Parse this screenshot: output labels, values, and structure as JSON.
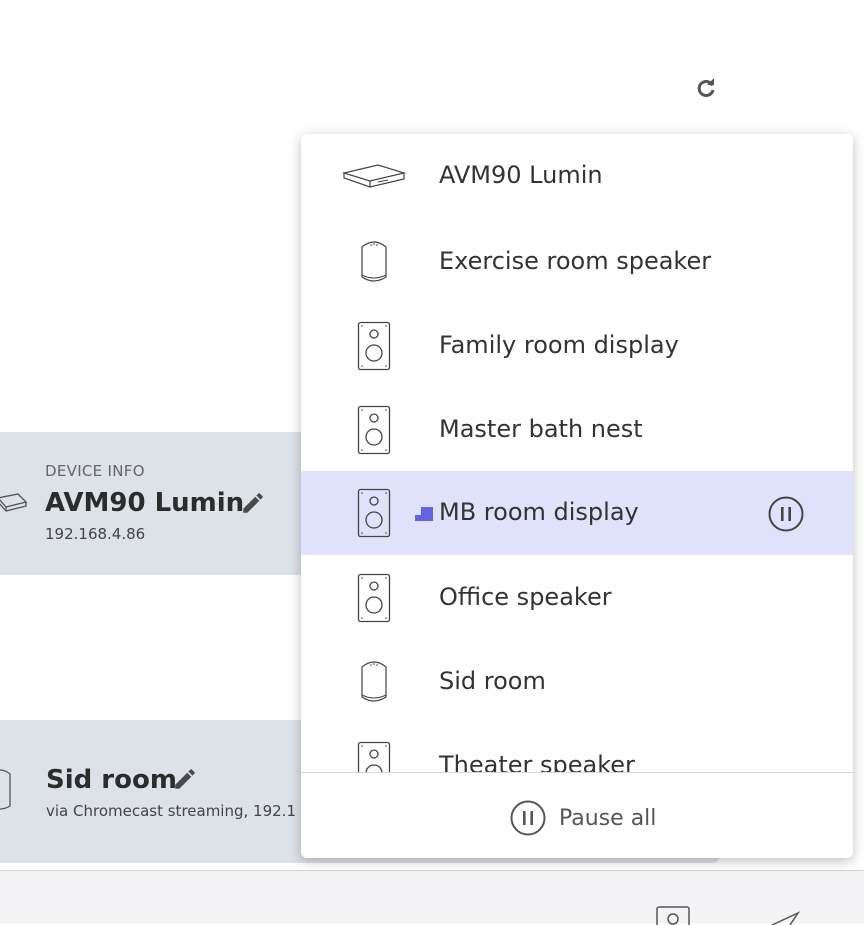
{
  "device_info": {
    "label": "DEVICE INFO",
    "name": "AVM90 Lumin",
    "ip": "192.168.4.86"
  },
  "sid_card": {
    "name": "Sid room",
    "subtitle": "via Chromecast streaming, 192.1"
  },
  "dropdown": {
    "items": [
      {
        "label": "AVM90 Lumin",
        "icon": "streamer-icon"
      },
      {
        "label": "Exercise room speaker",
        "icon": "smart-speaker-icon"
      },
      {
        "label": "Family room display",
        "icon": "speaker-icon"
      },
      {
        "label": "Master bath nest",
        "icon": "speaker-icon"
      },
      {
        "label": "MB room display",
        "icon": "speaker-icon",
        "selected": true,
        "playing": true
      },
      {
        "label": "Office speaker",
        "icon": "speaker-icon"
      },
      {
        "label": "Sid room",
        "icon": "smart-speaker-icon"
      },
      {
        "label": "Theater speaker",
        "icon": "speaker-icon"
      }
    ],
    "pause_all_label": "Pause all"
  },
  "colors": {
    "selected_bg": "#e0e1fb",
    "accent": "#6464e0",
    "card_bg": "#dde1e8"
  }
}
